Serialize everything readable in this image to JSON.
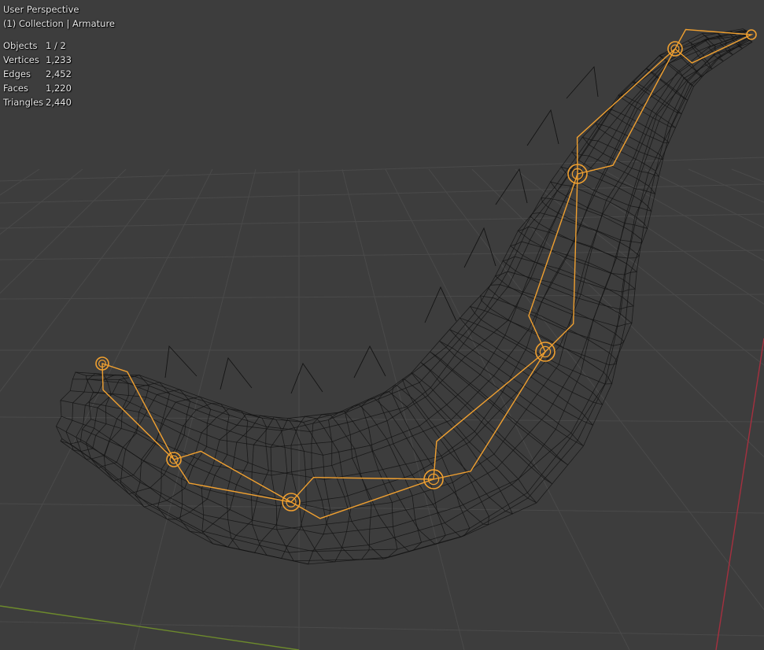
{
  "viewport": {
    "view_name": "User Perspective",
    "context": "(1) Collection | Armature"
  },
  "stats": [
    {
      "label": "Objects",
      "value": "1 / 2"
    },
    {
      "label": "Vertices",
      "value": "1,233"
    },
    {
      "label": "Edges",
      "value": "2,452"
    },
    {
      "label": "Faces",
      "value": "1,220"
    },
    {
      "label": "Triangles",
      "value": "2,440"
    }
  ],
  "colors": {
    "background": "#3d3d3d",
    "grid": "#4a4a4a",
    "x_axis": "#a5303f",
    "y_axis": "#6d8a2c",
    "wire": "#141414",
    "armature": "#f0a030"
  }
}
